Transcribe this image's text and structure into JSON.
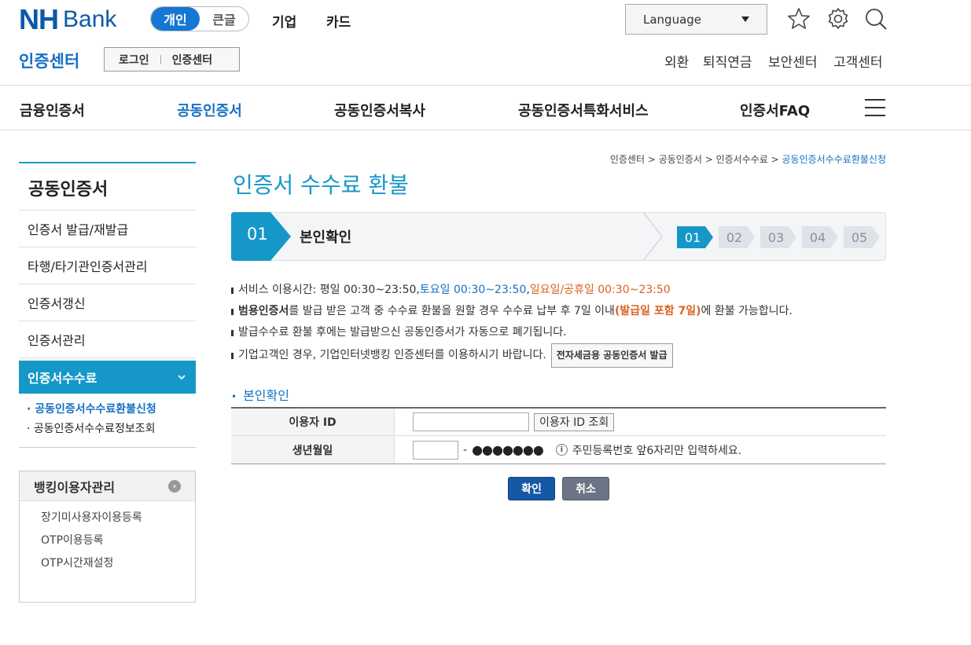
{
  "header": {
    "logo_nh": "NH",
    "logo_bank": "Bank",
    "seg_personal": "개인",
    "seg_large": "큰글",
    "nav_corp": "기업",
    "nav_card": "카드",
    "language": "Language"
  },
  "subheader": {
    "site_title": "인증센터",
    "login": "로그인",
    "cert_center": "인증센터",
    "util": [
      "외환",
      "퇴직연금",
      "보안센터",
      "고객센터"
    ]
  },
  "gnb": [
    "금융인증서",
    "공동인증서",
    "공동인증서복사",
    "공동인증서특화서비스",
    "인증서FAQ"
  ],
  "lnb": {
    "title": "공동인증서",
    "items": [
      "인증서 발급/재발급",
      "타행/타기관인증서관리",
      "인증서갱신",
      "인증서관리"
    ],
    "active": "인증서수수료",
    "sub": [
      "· 공동인증서수수료환불신청",
      "· 공동인증서수수료정보조회"
    ]
  },
  "bankbox": {
    "title": "뱅킹이용자관리",
    "items": [
      "장기미사용자이용등록",
      "OTP이용등록",
      "OTP시간재설정"
    ]
  },
  "breadcrumb": {
    "c1": "인증센터",
    "c2": "공동인증서",
    "c3": "인증서수수료",
    "c4": "공동인증서수수료환불신청",
    "sep": " > "
  },
  "page_title": "인증서 수수료 환불",
  "steps": {
    "current_num": "01",
    "current_label": "본인확인",
    "all": [
      "01",
      "02",
      "03",
      "04",
      "05"
    ]
  },
  "notes": {
    "n1_a": "서비스 이용시간: 평일 00:30~23:50, ",
    "n1_b": "토요일 00:30~23:50",
    "n1_c": ", ",
    "n1_d": "일요일/공휴일 00:30~23:50",
    "n2_a": "범용인증서",
    "n2_b": "를 발급 받은 고객 중 수수료 환불을 원할 경우 수수료 납부 후 7일 이내",
    "n2_c": "(발급일 포함 7일)",
    "n2_d": "에 환불 가능합니다.",
    "n3": "발급수수료 환불 후에는 발급받으신 공동인증서가 자동으로 폐기됩니다.",
    "n4": "기업고객인 경우, 기업인터넷뱅킹 인증센터를 이용하시기 바랍니다.",
    "n4_btn": "전자세금용 공동인증서 발급"
  },
  "form": {
    "section_title": "본인확인",
    "userid_label": "이용자 ID",
    "userid_value": "",
    "userid_btn": "이용자 ID 조회",
    "birth_label": "생년월일",
    "birth_value": "",
    "dash": "-",
    "mask": "●●●●●●●",
    "hint": "주민등록번호 앞6자리만 입력하세요."
  },
  "buttons": {
    "ok": "확인",
    "cancel": "취소"
  },
  "colors": {
    "brand": "#0a5aa8",
    "accent": "#1598c8",
    "active_nav": "#1570c4",
    "warning": "#d9621e"
  }
}
